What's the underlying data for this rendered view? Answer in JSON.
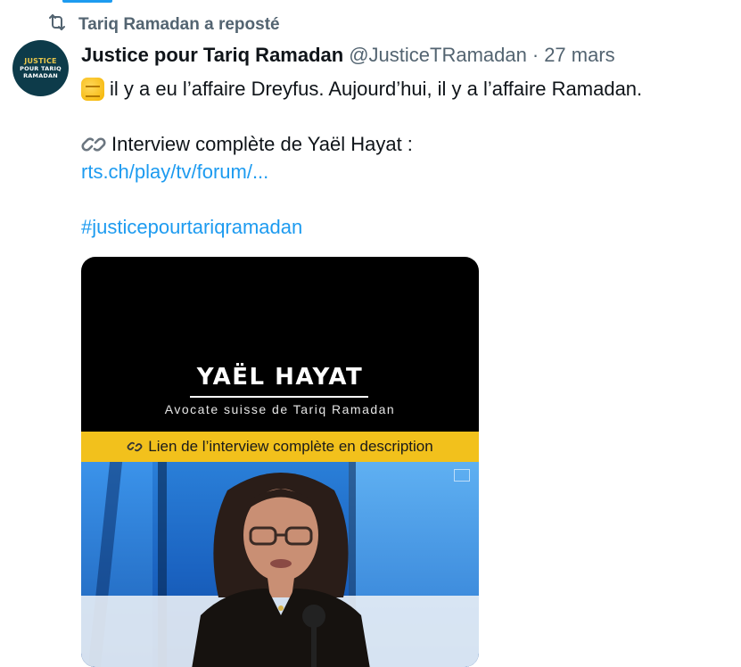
{
  "repost": {
    "label": "Tariq Ramadan a reposté",
    "icon": "repost-icon"
  },
  "author": {
    "avatar_text": [
      "JUSTICE",
      "POUR TARIQ",
      "RAMADAN"
    ],
    "display_name": "Justice pour Tariq Ramadan",
    "handle": "@JusticeTRamadan",
    "separator": "·",
    "date": "27 mars"
  },
  "tweet": {
    "line1": "il y a eu l’affaire Dreyfus. Aujourd’hui, il y a l’affaire Ramadan.",
    "line2": "Interview complète de Yaël Hayat :",
    "link": "rts.ch/play/tv/forum/...",
    "hashtag": "#justicepourtariqramadan"
  },
  "media": {
    "name": "YAËL HAYAT",
    "subtitle": "Avocate suisse de Tariq Ramadan",
    "banner": "Lien de l’interview complète en description"
  },
  "colors": {
    "accent": "#1d9bf0",
    "muted": "#536471",
    "banner": "#f2c11c"
  }
}
